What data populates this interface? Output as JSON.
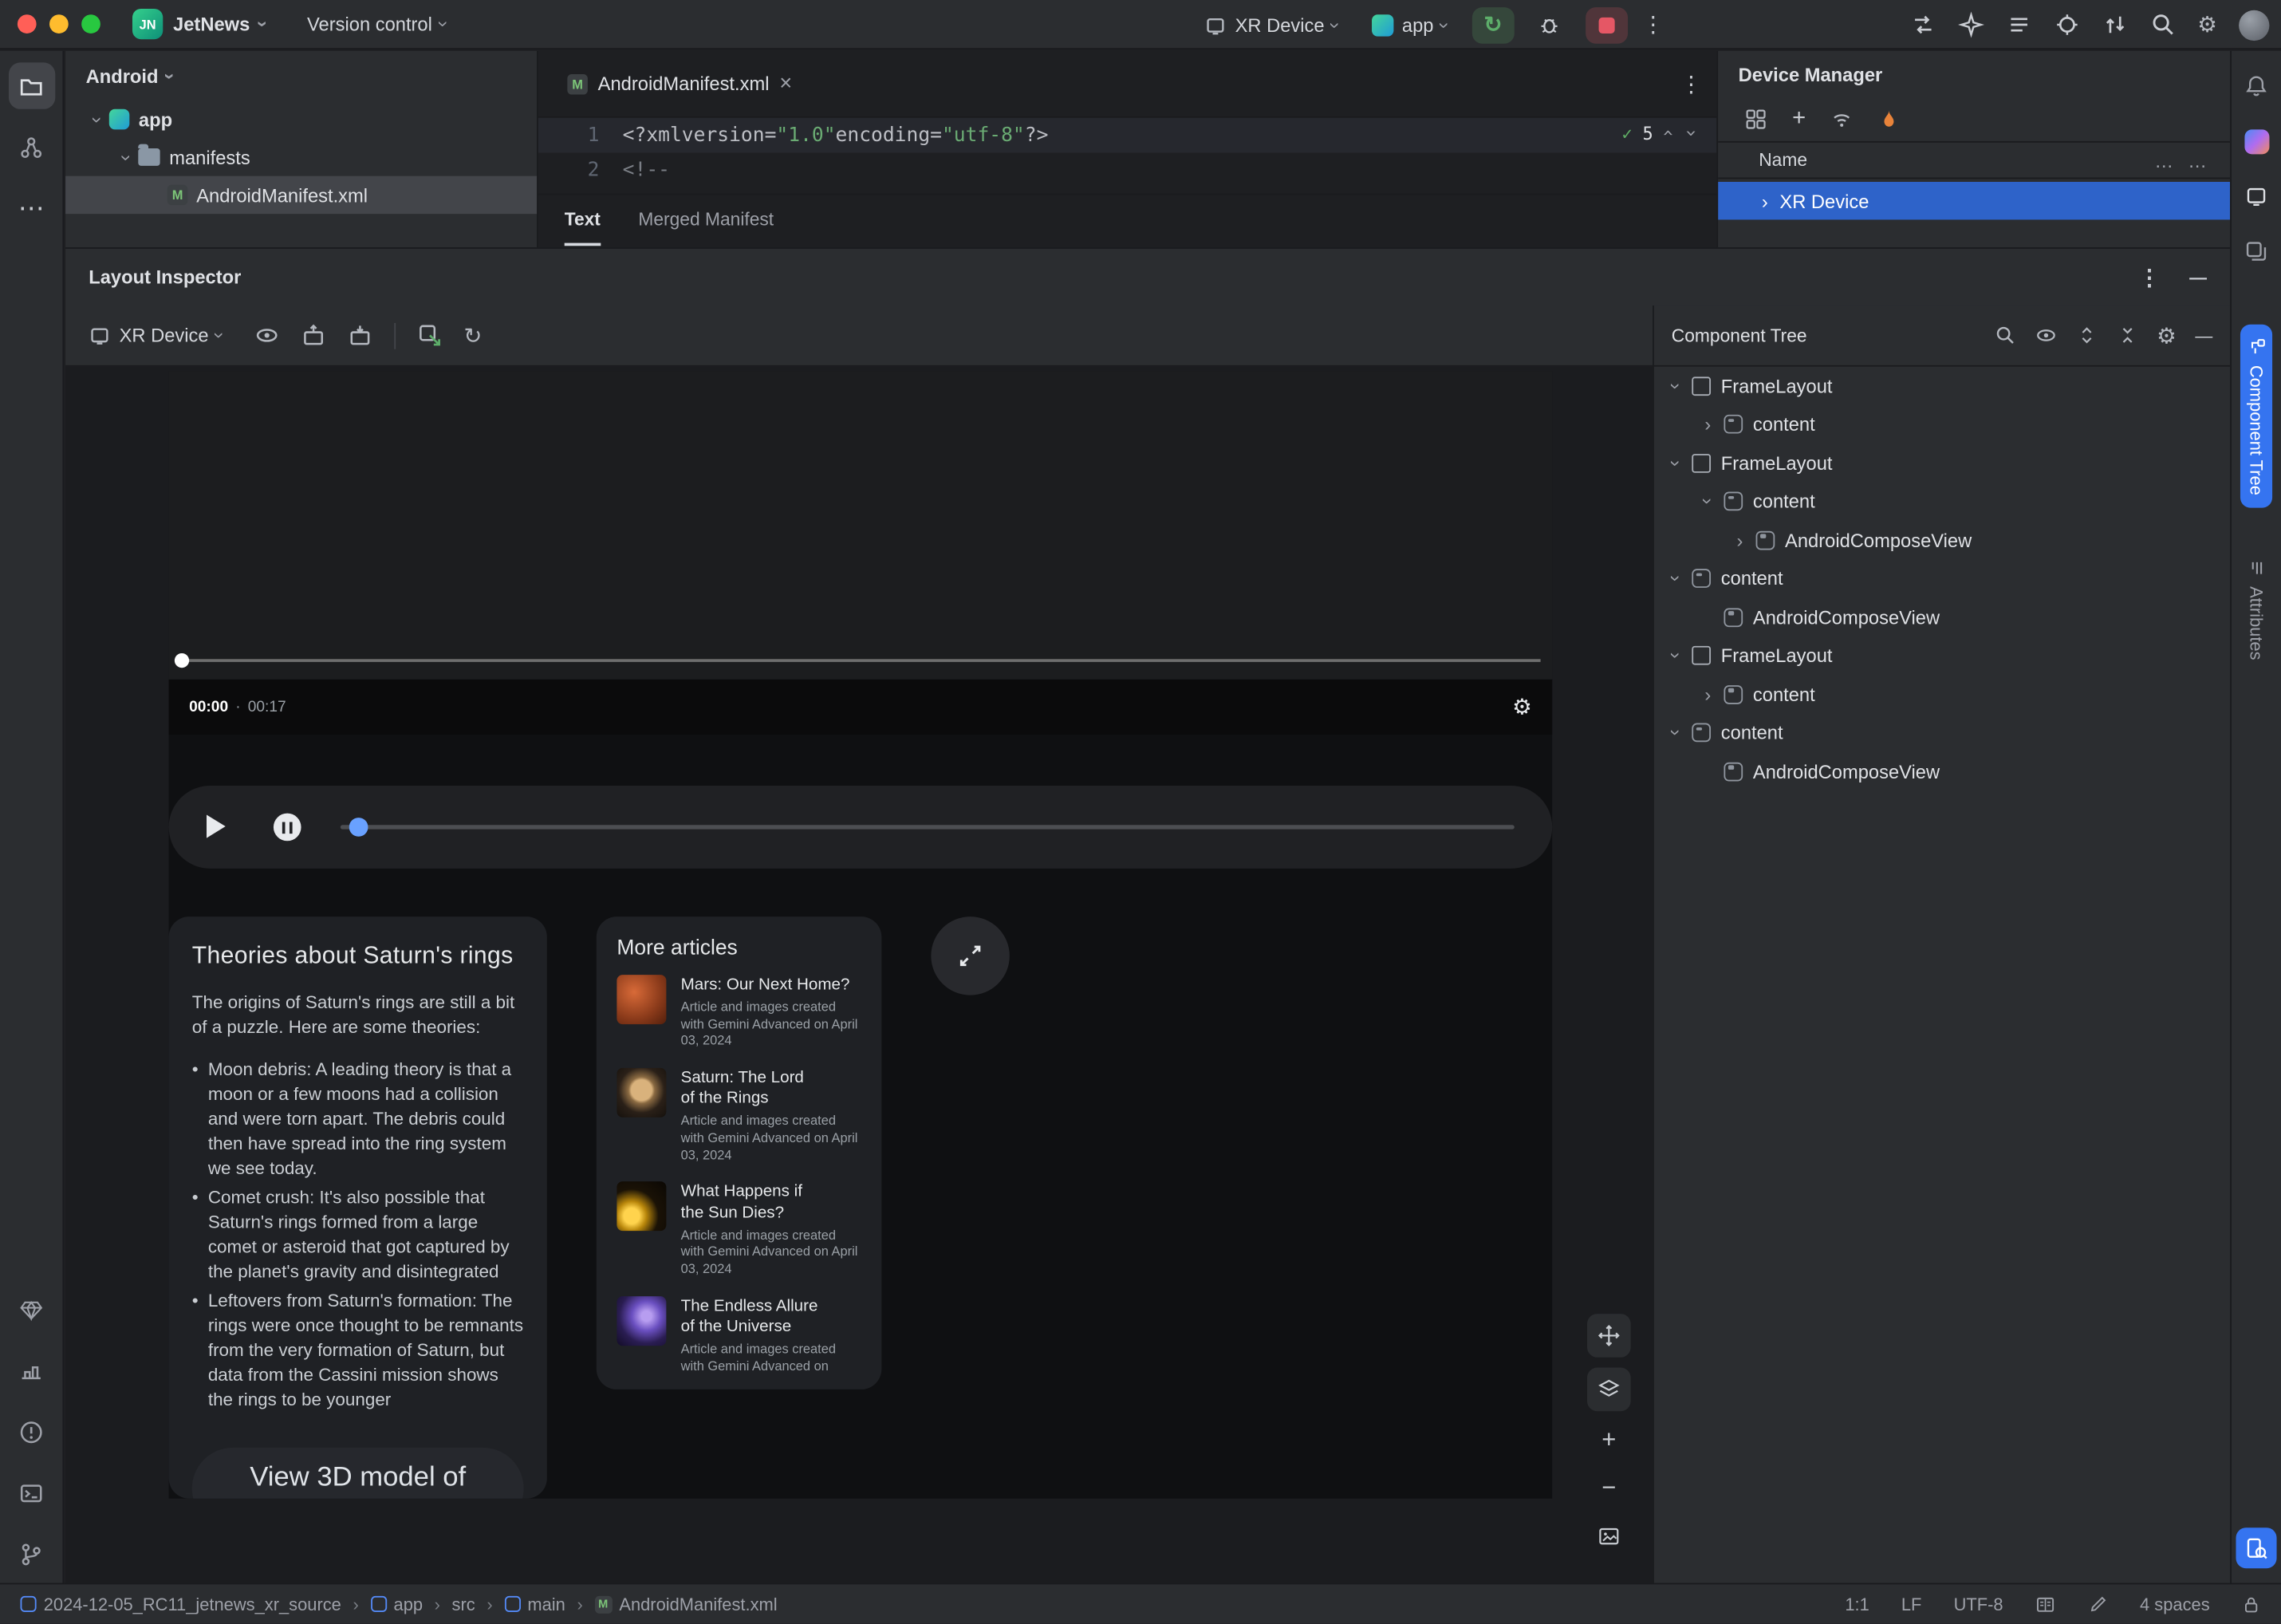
{
  "titlebar": {
    "logo": "JN",
    "project": "JetNews",
    "menu_version_control": "Version control",
    "device_selector": "XR Device",
    "run_config": "app"
  },
  "project_panel": {
    "title": "Android",
    "items": [
      {
        "label": "app"
      },
      {
        "label": "manifests"
      },
      {
        "label": "AndroidManifest.xml"
      }
    ]
  },
  "editor": {
    "tab_title": "AndroidManifest.xml",
    "file_badge": "M",
    "gutter": [
      "1",
      "2"
    ],
    "line1": [
      {
        "t": "<?xml "
      },
      {
        "t": "version="
      },
      {
        "t": "\"1.0\""
      },
      {
        "t": " encoding="
      },
      {
        "t": "\"utf-8\""
      },
      {
        "t": "?>"
      }
    ],
    "line2": "<!--",
    "inspections": "5",
    "bottom_tabs": [
      "Text",
      "Merged Manifest"
    ]
  },
  "device_manager": {
    "title": "Device Manager",
    "column_name": "Name",
    "ellipsis": "…",
    "selected_device": "XR Device"
  },
  "layout_inspector": {
    "title": "Layout Inspector",
    "device": "XR Device"
  },
  "app_preview": {
    "video": {
      "current": "00:00",
      "separator": "·",
      "total": "00:17"
    },
    "saturn_card": {
      "title": "Theories about Saturn's rings",
      "intro": "The origins of Saturn's rings are still a bit of a puzzle. Here are some theories:",
      "bullets": [
        "Moon debris: A leading theory is that a moon or a few moons had a collision and were torn apart. The debris could then have spread into the ring system we see today.",
        "Comet crush: It's also possible that Saturn's rings formed from a large comet or asteroid that got captured by the planet's gravity and disintegrated",
        "Leftovers from Saturn's formation: The rings were once thought to be remnants from the very formation of Saturn, but data from the Cassini mission shows the rings to be younger"
      ],
      "cta": "View 3D model of"
    },
    "more_articles": {
      "title": "More articles",
      "items": [
        {
          "title": "Mars: Our Next Home?",
          "caption": "Article and images created with Gemini Advanced on April 03, 2024"
        },
        {
          "title": "Saturn: The Lord of the Rings",
          "caption": "Article and images created with Gemini Advanced on April 03, 2024"
        },
        {
          "title": "What Happens if the Sun Dies?",
          "caption": "Article and images created with Gemini Advanced on April 03, 2024"
        },
        {
          "title": "The Endless Allure of the Universe",
          "caption": "Article and images created with Gemini Advanced on"
        }
      ]
    }
  },
  "component_tree": {
    "title": "Component Tree",
    "nodes": [
      {
        "label": "FrameLayout"
      },
      {
        "label": "content"
      },
      {
        "label": "FrameLayout"
      },
      {
        "label": "content"
      },
      {
        "label": "AndroidComposeView"
      },
      {
        "label": "content"
      },
      {
        "label": "AndroidComposeView"
      },
      {
        "label": "FrameLayout"
      },
      {
        "label": "content"
      },
      {
        "label": "content"
      },
      {
        "label": "AndroidComposeView"
      }
    ]
  },
  "right_sidebar": {
    "tab_component_tree": "Component Tree",
    "tab_attributes": "Attributes"
  },
  "statusbar": {
    "breadcrumb": [
      "2024-12-05_RC11_jetnews_xr_source",
      "app",
      "src",
      "main",
      "AndroidManifest.xml"
    ],
    "caret": "1:1",
    "line_sep": "LF",
    "encoding": "UTF-8",
    "indent": "4 spaces"
  },
  "colors": {
    "accent": "#3574F0",
    "selection_blue": "#2E63C9",
    "run_green": "#5DAE6A",
    "stop_red": "#E55765",
    "string_green": "#6AAB73",
    "flame_orange": "#E8833A"
  }
}
